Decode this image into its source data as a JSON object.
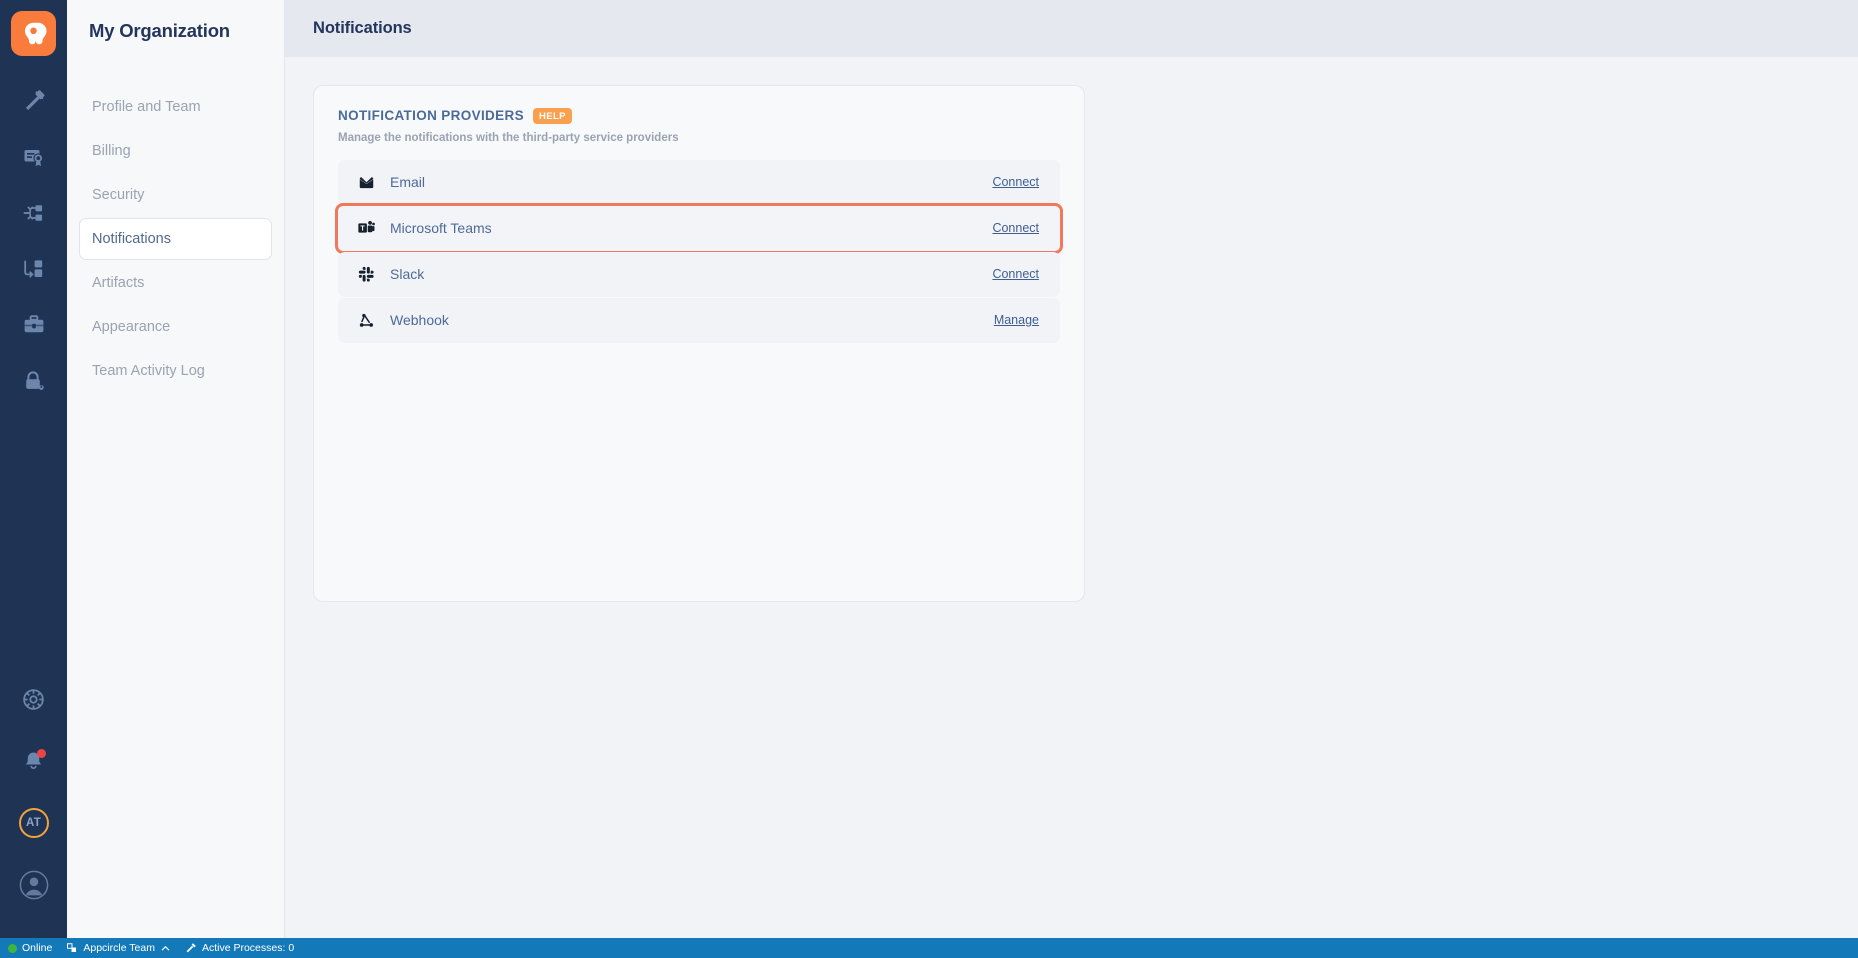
{
  "rail": {
    "logo": "appcircle-logo",
    "items": [
      {
        "name": "build-icon",
        "label": "Build"
      },
      {
        "name": "signing-identities-icon",
        "label": "Signing Identities"
      },
      {
        "name": "distribution-icon",
        "label": "Distribution"
      },
      {
        "name": "enterprise-store-icon",
        "label": "Enterprise App Store"
      },
      {
        "name": "testing-distribution-icon",
        "label": "Testing Distribution"
      },
      {
        "name": "security-icon",
        "label": "Security"
      }
    ],
    "bottom": [
      {
        "name": "resources-icon",
        "label": "Resources"
      },
      {
        "name": "notifications-bell-icon",
        "label": "Notifications",
        "has_badge": true
      },
      {
        "name": "organization-avatar",
        "label": "AT"
      },
      {
        "name": "user-avatar",
        "label": "Account"
      }
    ]
  },
  "sidebar": {
    "title": "My Organization",
    "items": [
      {
        "label": "Profile and Team",
        "active": false
      },
      {
        "label": "Billing",
        "active": false
      },
      {
        "label": "Security",
        "active": false
      },
      {
        "label": "Notifications",
        "active": true
      },
      {
        "label": "Artifacts",
        "active": false
      },
      {
        "label": "Appearance",
        "active": false
      },
      {
        "label": "Team Activity Log",
        "active": false
      }
    ]
  },
  "topbar": {
    "title": "Notifications"
  },
  "card": {
    "title": "NOTIFICATION PROVIDERS",
    "help_badge": "HELP",
    "subtitle": "Manage the notifications with the third-party service providers",
    "providers": [
      {
        "icon": "email-icon",
        "name": "Email",
        "action": "Connect",
        "highlighted": false
      },
      {
        "icon": "microsoft-teams-icon",
        "name": "Microsoft Teams",
        "action": "Connect",
        "highlighted": true
      },
      {
        "icon": "slack-icon",
        "name": "Slack",
        "action": "Connect",
        "highlighted": false
      },
      {
        "icon": "webhook-icon",
        "name": "Webhook",
        "action": "Manage",
        "highlighted": false
      }
    ]
  },
  "statusbar": {
    "online": "Online",
    "organization": "Appcircle Team",
    "processes": "Active Processes: 0"
  },
  "colors": {
    "accent_orange": "#f97c3c",
    "highlight_outline": "#f0785c",
    "rail_bg": "#1f3354",
    "statusbar_bg": "#1479b8",
    "help_badge": "#f9a04f"
  }
}
